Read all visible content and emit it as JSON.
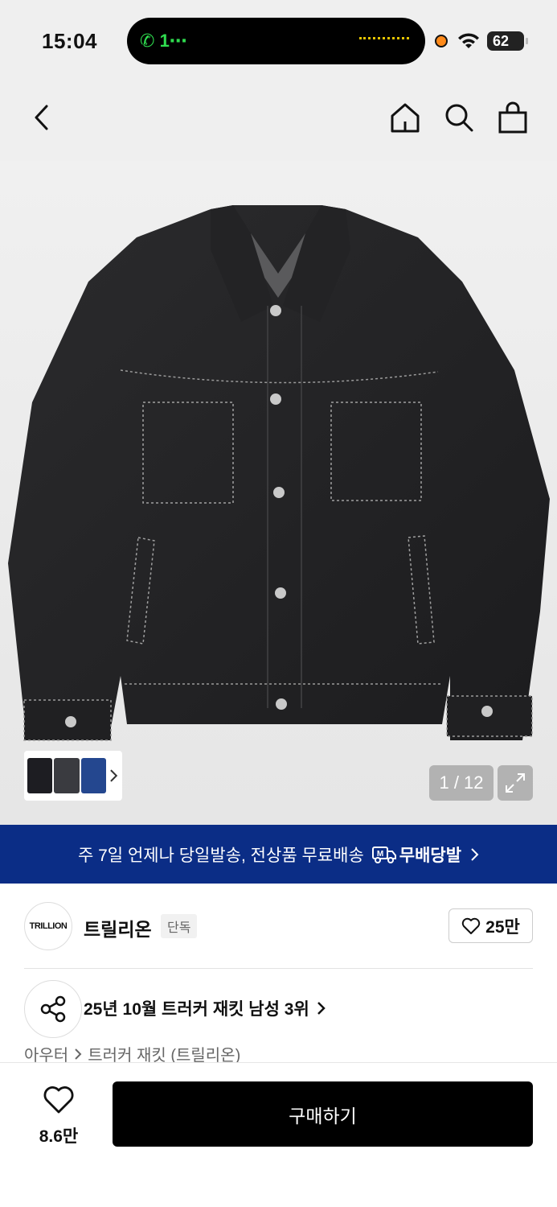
{
  "status": {
    "time": "15:04",
    "call": "1⋯",
    "battery": "62"
  },
  "gallery": {
    "counter": "1 / 12"
  },
  "banner": {
    "text": "주 7일 언제나 당일발송, 전상품 무료배송",
    "brand": "무배당발"
  },
  "brand": {
    "logo_text": "TRILLION",
    "name": "트릴리온",
    "tag": "단독",
    "likes": "25만"
  },
  "ranking": {
    "text": "25년 10월 트러커 재킷 남성 3위"
  },
  "breadcrumb": {
    "level1": "아우터",
    "level2": "트러커 재킷 (트릴리온)"
  },
  "bottom": {
    "wish_count": "8.6만",
    "buy_label": "구매하기"
  },
  "colors": {
    "banner": "#0b2d86",
    "buy": "#000000",
    "call": "#2fdc4f"
  }
}
